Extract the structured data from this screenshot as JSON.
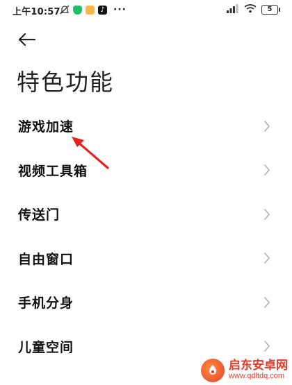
{
  "status_bar": {
    "time": "上午10:57",
    "more": "···",
    "battery": "5",
    "icons": [
      "mute-icon",
      "shield-icon",
      "message-icon",
      "tiktok-icon",
      "signal-icon",
      "wifi-icon",
      "battery-icon"
    ]
  },
  "header": {
    "back_icon": "arrow-left-icon",
    "title": "特色功能"
  },
  "list": {
    "items": [
      {
        "label": "游戏加速"
      },
      {
        "label": "视频工具箱"
      },
      {
        "label": "传送门"
      },
      {
        "label": "自由窗口"
      },
      {
        "label": "手机分身"
      },
      {
        "label": "儿童空间"
      }
    ]
  },
  "annotation": {
    "arrow_color": "#e5211d"
  },
  "watermark": {
    "name": "启东安卓网",
    "url": "www.qdltdq.com"
  },
  "colors": {
    "text": "#111111",
    "chevron": "#b8b8b8",
    "background": "#ffffff"
  }
}
